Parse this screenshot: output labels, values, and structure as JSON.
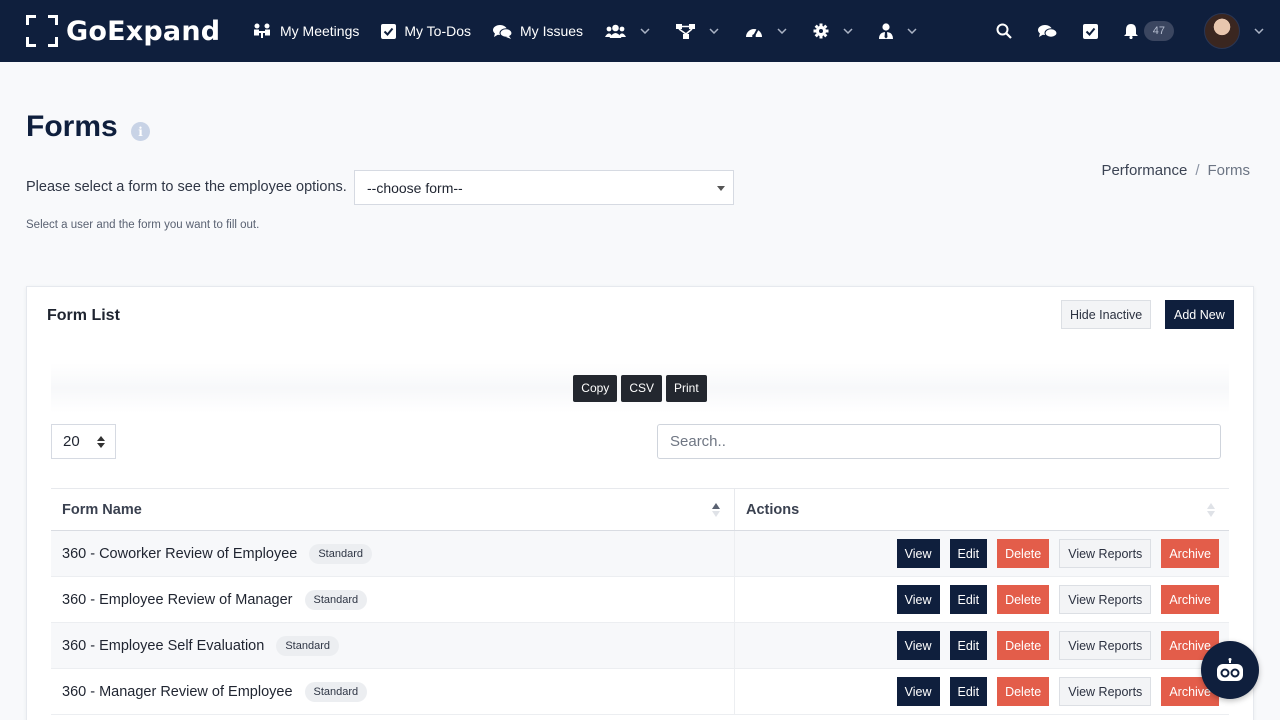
{
  "app": {
    "logo_text": "GoExpand",
    "colors": {
      "navbar": "#0f1f3d",
      "primary": "#0f1f3d",
      "danger": "#e35d4a"
    }
  },
  "nav": {
    "links": [
      {
        "label": "My Meetings",
        "icon": "meetings-icon"
      },
      {
        "label": "My To-Dos",
        "icon": "checkbox-icon"
      },
      {
        "label": "My Issues",
        "icon": "comments-icon"
      }
    ],
    "icon_menus": [
      "users-icon",
      "org-chart-icon",
      "dashboard-icon",
      "gear-icon",
      "user-tie-icon"
    ],
    "right_icons": [
      "search-icon",
      "chat-icon",
      "todo-check-icon",
      "bell-icon"
    ],
    "notification_count": "47"
  },
  "page": {
    "title": "Forms",
    "breadcrumb": {
      "parent": "Performance",
      "separator": "/",
      "current": "Forms"
    },
    "select_label": "Please select a form to see the employee options.",
    "form_select_value": "--choose form--",
    "help_text": "Select a user and the form you want to fill out."
  },
  "card": {
    "title": "Form List",
    "hide_inactive_label": "Hide Inactive",
    "add_new_label": "Add New",
    "export_buttons": {
      "copy": "Copy",
      "csv": "CSV",
      "print": "Print"
    },
    "page_length": "20",
    "search_placeholder": "Search.."
  },
  "table": {
    "columns": [
      "Form Name",
      "Actions"
    ],
    "action_labels": {
      "view": "View",
      "edit": "Edit",
      "delete": "Delete",
      "reports": "View Reports",
      "archive": "Archive"
    },
    "rows": [
      {
        "name": "360 - Coworker Review of Employee",
        "badge": "Standard"
      },
      {
        "name": "360 - Employee Review of Manager",
        "badge": "Standard"
      },
      {
        "name": "360 - Employee Self Evaluation",
        "badge": "Standard"
      },
      {
        "name": "360 - Manager Review of Employee",
        "badge": "Standard"
      }
    ]
  }
}
